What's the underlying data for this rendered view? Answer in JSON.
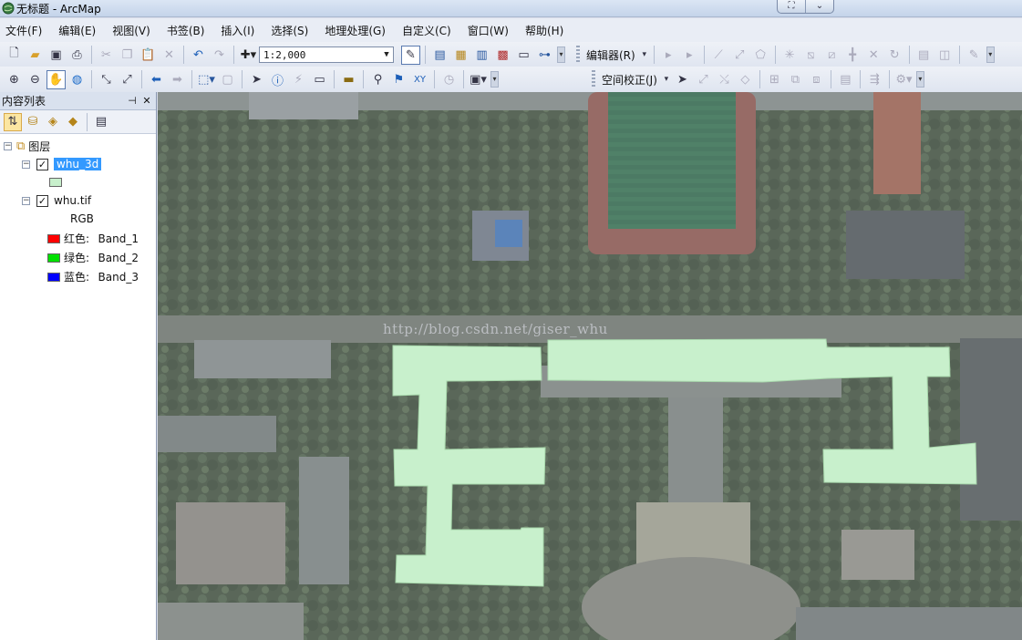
{
  "window": {
    "title": "无标题 - ArcMap"
  },
  "menu": [
    "文件(F)",
    "编辑(E)",
    "视图(V)",
    "书签(B)",
    "插入(I)",
    "选择(S)",
    "地理处理(G)",
    "自定义(C)",
    "窗口(W)",
    "帮助(H)"
  ],
  "toolbar1": {
    "scale_value": "1:2,000",
    "editor_label": "编辑器(R)"
  },
  "toolbar2": {
    "georef_label": "空间校正(J)"
  },
  "toc": {
    "title": "内容列表",
    "root_label": "图层",
    "layers": [
      {
        "name": "whu_3d",
        "checked": true,
        "selected": true,
        "symbol_color": "#c8f0cc"
      },
      {
        "name": "whu.tif",
        "checked": true,
        "renderer": "RGB",
        "bands": [
          {
            "color": "#ff0000",
            "label": "红色:",
            "band": "Band_1"
          },
          {
            "color": "#00e000",
            "label": "绿色:",
            "band": "Band_2"
          },
          {
            "color": "#0000ff",
            "label": "蓝色:",
            "band": "Band_3"
          }
        ]
      }
    ]
  },
  "map": {
    "watermark": "http://blog.csdn.net/giser_whu",
    "polygon_fill": "#c8f0cc"
  }
}
